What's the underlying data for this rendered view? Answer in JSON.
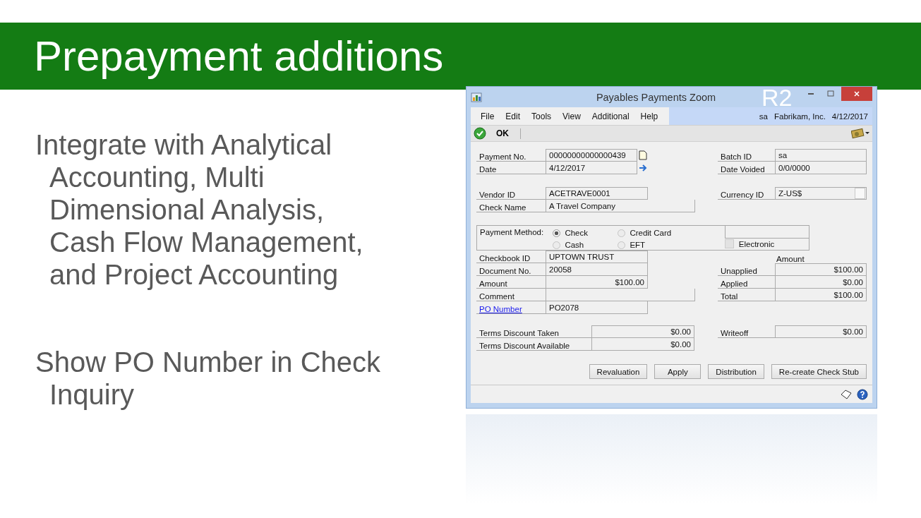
{
  "slide": {
    "title": "Prepayment additions",
    "bullets": [
      {
        "text": "Integrate with Analytical Accounting, Multi Dimensional Analysis, Cash Flow Management, and Project Accounting"
      },
      {
        "text": "Show PO Number in Check Inquiry"
      }
    ],
    "overlay": "R2"
  },
  "window": {
    "title": "Payables Payments Zoom",
    "menu": [
      "File",
      "Edit",
      "Tools",
      "View",
      "Additional",
      "Help"
    ],
    "user": "sa",
    "company": "Fabrikam, Inc.",
    "date": "4/12/2017",
    "toolbar": {
      "ok": "OK"
    },
    "header_left": [
      {
        "label": "Payment No.",
        "value": "00000000000000439",
        "kind": "note"
      },
      {
        "label": "Date",
        "value": "4/12/2017",
        "kind": "arrow"
      }
    ],
    "header_right": [
      {
        "label": "Batch ID",
        "value": "sa"
      },
      {
        "label": "Date Voided",
        "value": "0/0/0000"
      }
    ],
    "vendor": [
      {
        "label": "Vendor ID",
        "value": "ACETRAVE0001"
      },
      {
        "label": "Check Name",
        "value": "A Travel Company"
      }
    ],
    "currency": {
      "label": "Currency ID",
      "value": "Z-US$"
    },
    "payment_method": {
      "label": "Payment Method:",
      "options": [
        {
          "label": "Check",
          "selected": true
        },
        {
          "label": "Credit Card",
          "selected": false
        },
        {
          "label": "Cash",
          "selected": false
        },
        {
          "label": "EFT",
          "selected": false
        }
      ],
      "electronic": {
        "label": "Electronic",
        "checked": false,
        "disabled": true
      }
    },
    "details": [
      {
        "label": "Checkbook ID",
        "value": "UPTOWN TRUST",
        "kind": "text"
      },
      {
        "label": "Document No.",
        "value": "20058",
        "kind": "text"
      },
      {
        "label": "Amount",
        "value": "$100.00",
        "kind": "amount"
      },
      {
        "label": "Comment",
        "kind": "text"
      },
      {
        "label": "PO Number",
        "value": "PO2078",
        "kind": "link"
      }
    ],
    "amount_header": "Amount",
    "totals": [
      {
        "label": "Unapplied",
        "value": "$100.00"
      },
      {
        "label": "Applied",
        "value": "$0.00"
      },
      {
        "label": "Total",
        "value": "$100.00"
      }
    ],
    "discounts": [
      {
        "label": "Terms Discount Taken",
        "value": "$0.00"
      },
      {
        "label": "Terms Discount Available",
        "value": "$0.00"
      }
    ],
    "writeoff": {
      "label": "Writeoff",
      "value": "$0.00"
    },
    "buttons": [
      "Revaluation",
      "Apply",
      "Distribution",
      "Re-create Check Stub"
    ]
  }
}
